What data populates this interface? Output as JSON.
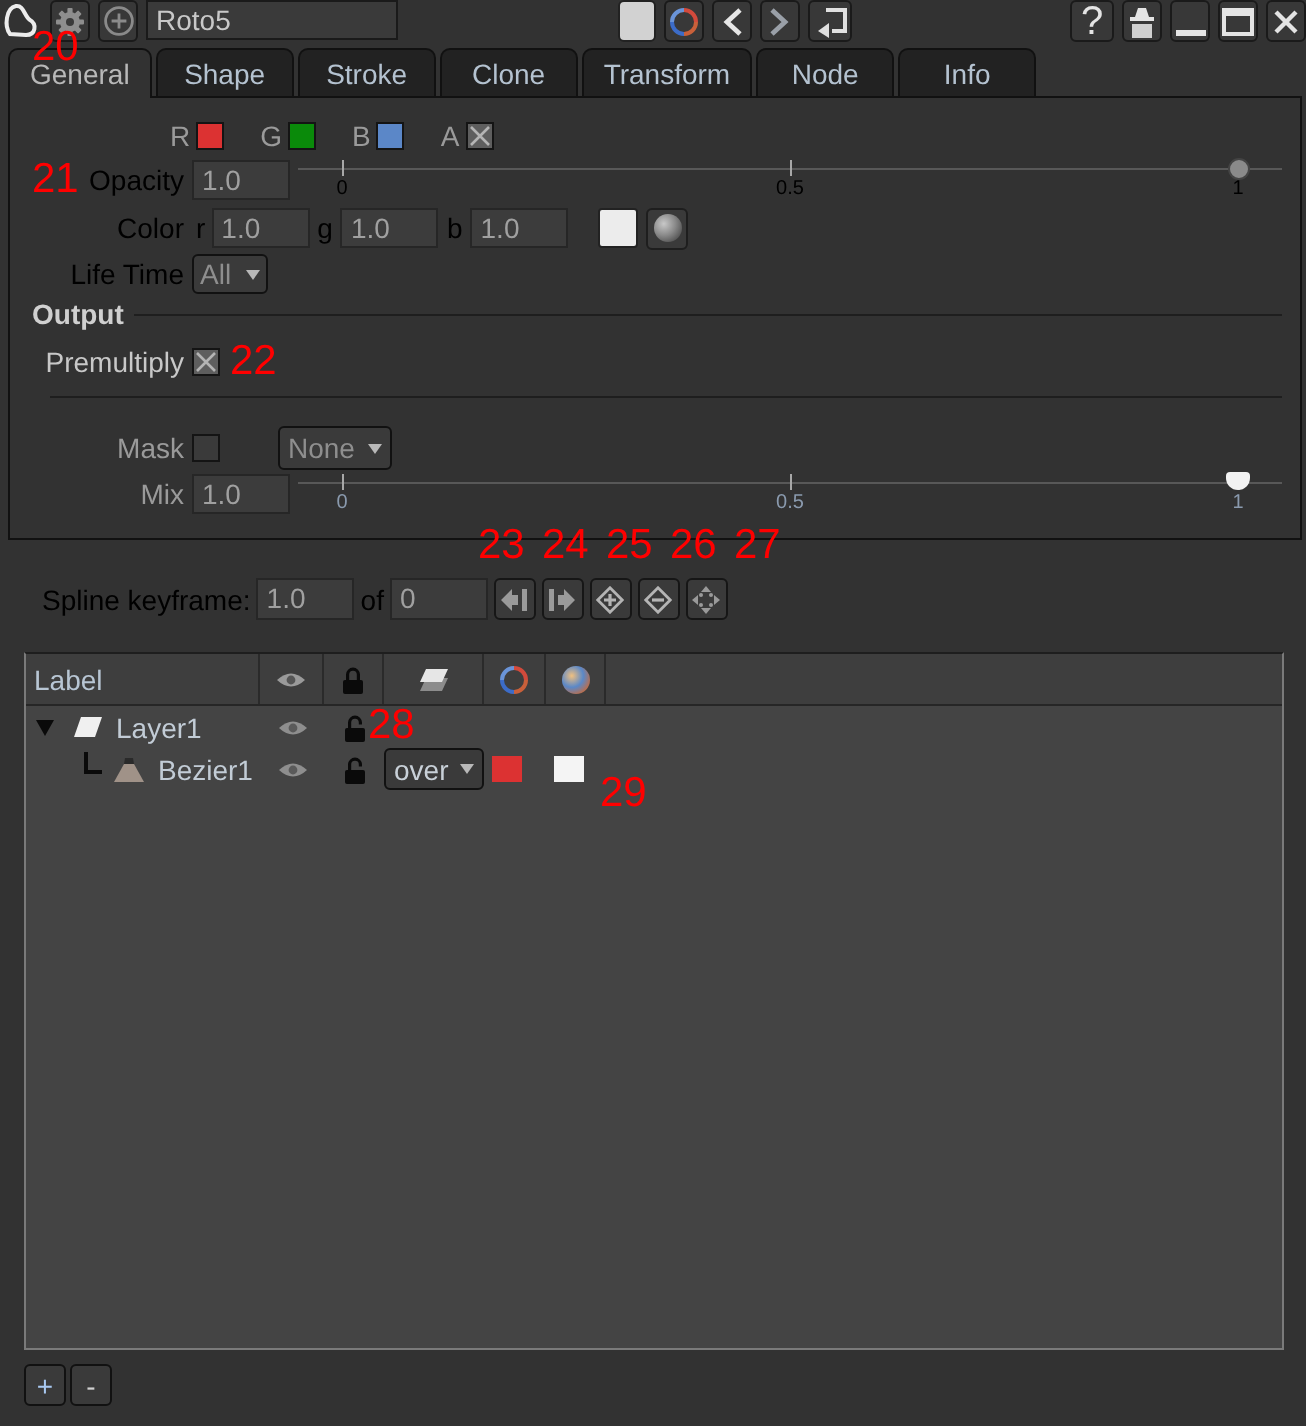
{
  "toolbar": {
    "left": [
      {
        "kind": "logo"
      },
      {
        "kind": "settings",
        "callout": "20"
      },
      {
        "kind": "add"
      }
    ],
    "node_name": "Roto5",
    "middle": [
      {
        "kind": "swatch"
      },
      {
        "kind": "wheel"
      },
      {
        "kind": "prev"
      },
      {
        "kind": "next"
      },
      {
        "kind": "return"
      }
    ],
    "right": [
      {
        "kind": "help",
        "label": "?"
      },
      {
        "kind": "float"
      },
      {
        "kind": "minimize"
      },
      {
        "kind": "maximize"
      },
      {
        "kind": "close"
      }
    ]
  },
  "tabs": [
    {
      "label": "General",
      "selected": true
    },
    {
      "label": "Shape",
      "selected": false
    },
    {
      "label": "Stroke",
      "selected": false
    },
    {
      "label": "Clone",
      "selected": false
    },
    {
      "label": "Transform",
      "selected": false
    },
    {
      "label": "Node",
      "selected": false
    },
    {
      "label": "Info",
      "selected": false
    }
  ],
  "channels": [
    {
      "label": "R",
      "checked": true,
      "color": "#dc3232"
    },
    {
      "label": "G",
      "checked": true,
      "color": "#0a8a0a"
    },
    {
      "label": "B",
      "checked": true,
      "color": "#5b87c8"
    },
    {
      "label": "A",
      "checked": true
    }
  ],
  "opacity": {
    "label": "Opacity",
    "value": "1.0",
    "level": 1,
    "ticks": [
      "0",
      "0.5",
      "1"
    ],
    "callout": "21"
  },
  "color": {
    "label": "Color",
    "channels": [
      {
        "label": "r",
        "value": "1.0"
      },
      {
        "label": "g",
        "value": "1.0"
      },
      {
        "label": "b",
        "value": "1.0"
      }
    ]
  },
  "life_time": {
    "label": "Life Time",
    "value": "All"
  },
  "output": {
    "title": "Output",
    "premultiply": {
      "label": "Premultiply",
      "checked": true,
      "callout": "22"
    }
  },
  "mask": {
    "label": "Mask",
    "checked": false,
    "value": "None"
  },
  "mix": {
    "label": "Mix",
    "value": "1.0",
    "level": 1,
    "ticks": [
      "0",
      "0.5",
      "1"
    ]
  },
  "spline_keyframe": {
    "label": "Spline keyframe:",
    "value": "1.0",
    "of_label": "of",
    "total": "0",
    "buttons": [
      {
        "kind": "previous",
        "callout": "23"
      },
      {
        "kind": "next",
        "callout": "24"
      },
      {
        "kind": "add",
        "callout": "25"
      },
      {
        "kind": "delete",
        "callout": "26"
      },
      {
        "kind": "reset",
        "callout": "27"
      }
    ]
  },
  "layers": {
    "columns": [
      {
        "kind": "text",
        "label": "Label"
      },
      {
        "kind": "eye"
      },
      {
        "kind": "lock"
      },
      {
        "kind": "stack"
      },
      {
        "kind": "wheel"
      },
      {
        "kind": "sphere"
      }
    ],
    "rows": [
      {
        "name": "Layer1",
        "kind": "layer",
        "expanded": true,
        "visible": true,
        "locked": false,
        "callout": "28",
        "children": [
          {
            "name": "Bezier1",
            "kind": "bezier",
            "visible": true,
            "locked": false,
            "blend": "over",
            "swatches": [
              {
                "color": "#dc3232"
              },
              {
                "color": "#f4f4f4"
              }
            ],
            "callout": "29"
          }
        ]
      }
    ]
  },
  "footer_buttons": [
    {
      "label": "+"
    },
    {
      "label": "-"
    }
  ]
}
